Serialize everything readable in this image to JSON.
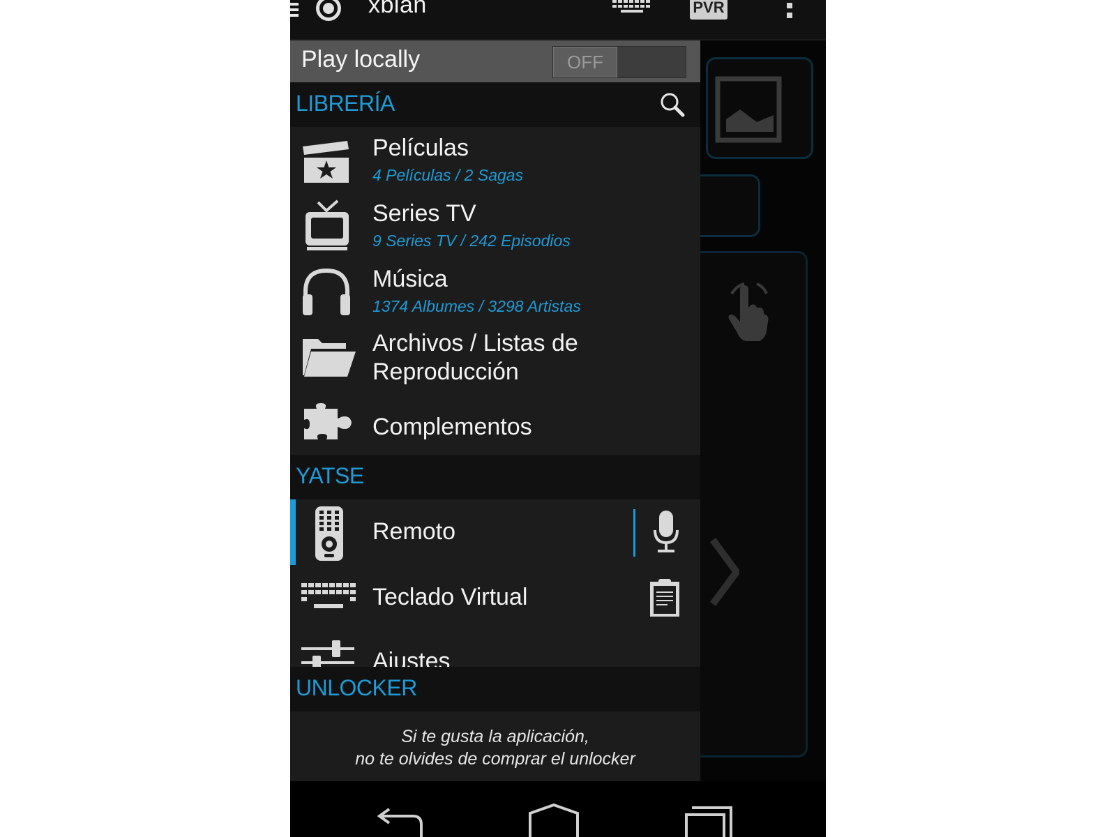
{
  "app": {
    "title": "xbian",
    "pvr_label": "PVR"
  },
  "play_locally": {
    "label": "Play locally",
    "toggle_state": "OFF"
  },
  "sections": {
    "library": {
      "title": "LIBRERÍA",
      "items": [
        {
          "label": "Películas",
          "sub": "4 Películas / 2 Sagas",
          "icon": "clapperboard-icon"
        },
        {
          "label": "Series TV",
          "sub": "9 Series TV / 242 Episodios",
          "icon": "tv-icon"
        },
        {
          "label": "Música",
          "sub": "1374 Albumes / 3298 Artistas",
          "icon": "headphones-icon"
        },
        {
          "label_line1": "Archivos / Listas de",
          "label_line2": "Reproducción",
          "icon": "folder-icon"
        },
        {
          "label": "Complementos",
          "icon": "puzzle-icon"
        }
      ]
    },
    "yatse": {
      "title": "YATSE",
      "items": [
        {
          "label": "Remoto",
          "icon": "remote-icon",
          "action_icon": "microphone-icon"
        },
        {
          "label": "Teclado Virtual",
          "icon": "keyboard-icon",
          "action_icon": "clipboard-icon"
        },
        {
          "label": "Ajustes",
          "icon": "sliders-icon"
        }
      ]
    },
    "unlocker": {
      "title": "UNLOCKER",
      "message_line1": "Si te gusta la aplicación,",
      "message_line2": "no te olvides de comprar el unlocker"
    }
  },
  "colors": {
    "accent": "#1e9ad6",
    "drawer_bg": "#1c1c1c",
    "header_bg": "#111111",
    "toggle_row_bg": "#555555"
  }
}
